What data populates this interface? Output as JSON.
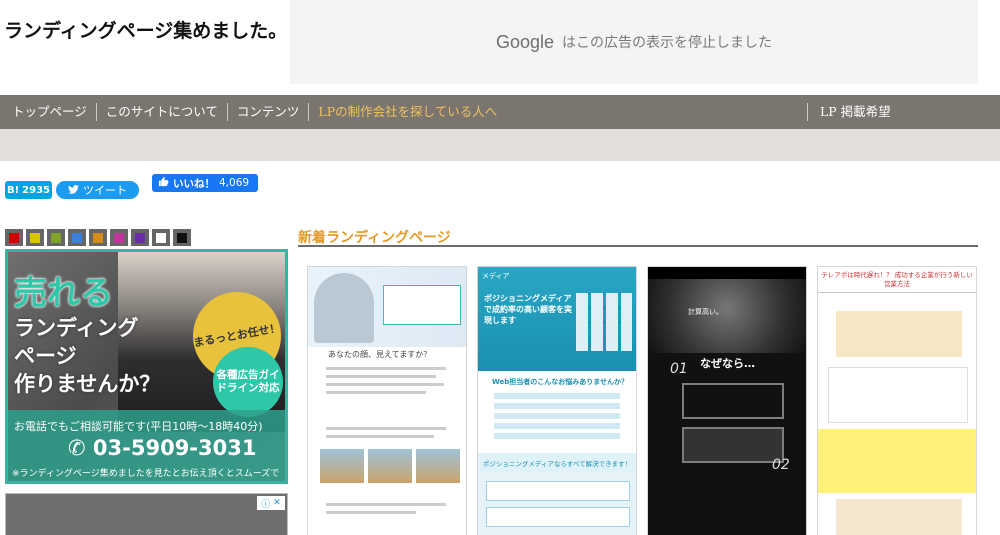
{
  "site": {
    "title": "ランディングページ集めました。"
  },
  "ad_banner": {
    "brand": "Google",
    "message": "はこの広告の表示を停止しました"
  },
  "nav": {
    "items": [
      {
        "label": "トップページ"
      },
      {
        "label": "このサイトについて"
      },
      {
        "label": "コンテンツ"
      },
      {
        "label": "LPの制作会社を探している人へ",
        "active": true
      }
    ],
    "right_item": "LP 掲載希望"
  },
  "social": {
    "hatena_label": "B!",
    "hatena_count": "2935",
    "tweet_label": "ツイート",
    "like_label": "いいね！",
    "like_count": "4,069"
  },
  "swatches": [
    "#d00000",
    "#d8c400",
    "#7ea32a",
    "#3b7fd6",
    "#d98a1c",
    "#c0369a",
    "#6a2ca8",
    "#ffffff",
    "#111111"
  ],
  "side_ad": {
    "headline": "売れる",
    "subline1": "ランディング",
    "subline2": "ページ",
    "subline3": "作りませんか？",
    "badge1": "まるっとお任せ！",
    "badge2": "各種広告ガイドライン対応",
    "contact": "お電話でもご相談可能です(平日10時〜18時40分)",
    "phone": "03-5909-3031",
    "note": "※ランディングページ集めましたを見たとお伝え頂くとスムーズです。"
  },
  "section": {
    "title": "新着ランディングページ"
  },
  "cards": [
    {
      "headline": "あなたの顔、見えてますか？",
      "highlight": "顔"
    },
    {
      "brand": "メディア",
      "headline": "ポジショニングメディアで成約率の高い顧客を実現します",
      "question": "Web担当者のこんなお悩みありませんか？",
      "band": "ポジショニングメディアならすべて解決できます！"
    },
    {
      "headline": "なぜなら…",
      "tagline": "計算高い。",
      "num1": "01",
      "num2": "02"
    },
    {
      "header": "テレアポは時代遅れ！？ 成功する企業が行う新しい営業方法"
    }
  ],
  "colors": {
    "nav_bg": "#7b7570",
    "nav_active": "#f0c25a",
    "section_title": "#e49a2a",
    "ad_accent": "#2ec7a8"
  }
}
